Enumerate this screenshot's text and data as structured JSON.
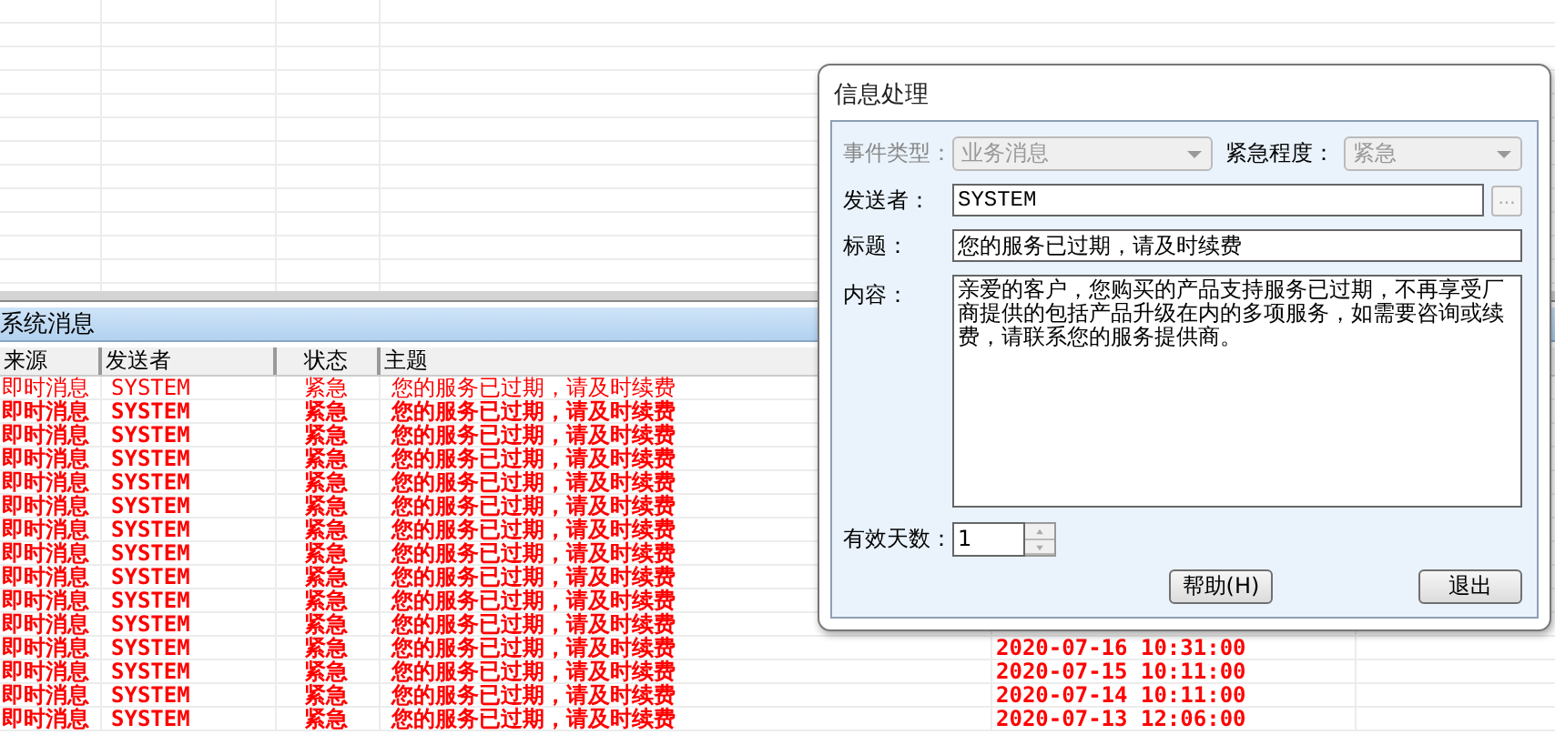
{
  "message_panel": {
    "title": "系统消息",
    "columns": [
      "来源",
      "发送者",
      "状态",
      "主题"
    ],
    "rows": [
      {
        "source": "即时消息",
        "sender": "SYSTEM",
        "status": "紧急",
        "subject": "您的服务已过期，请及时续费",
        "unread": false
      },
      {
        "source": "即时消息",
        "sender": "SYSTEM",
        "status": "紧急",
        "subject": "您的服务已过期，请及时续费",
        "unread": true
      },
      {
        "source": "即时消息",
        "sender": "SYSTEM",
        "status": "紧急",
        "subject": "您的服务已过期，请及时续费",
        "unread": true
      },
      {
        "source": "即时消息",
        "sender": "SYSTEM",
        "status": "紧急",
        "subject": "您的服务已过期，请及时续费",
        "unread": true
      },
      {
        "source": "即时消息",
        "sender": "SYSTEM",
        "status": "紧急",
        "subject": "您的服务已过期，请及时续费",
        "unread": true
      },
      {
        "source": "即时消息",
        "sender": "SYSTEM",
        "status": "紧急",
        "subject": "您的服务已过期，请及时续费",
        "unread": true
      },
      {
        "source": "即时消息",
        "sender": "SYSTEM",
        "status": "紧急",
        "subject": "您的服务已过期，请及时续费",
        "unread": true
      },
      {
        "source": "即时消息",
        "sender": "SYSTEM",
        "status": "紧急",
        "subject": "您的服务已过期，请及时续费",
        "unread": true
      },
      {
        "source": "即时消息",
        "sender": "SYSTEM",
        "status": "紧急",
        "subject": "您的服务已过期，请及时续费",
        "unread": true
      },
      {
        "source": "即时消息",
        "sender": "SYSTEM",
        "status": "紧急",
        "subject": "您的服务已过期，请及时续费",
        "unread": true
      },
      {
        "source": "即时消息",
        "sender": "SYSTEM",
        "status": "紧急",
        "subject": "您的服务已过期，请及时续费",
        "unread": true
      },
      {
        "source": "即时消息",
        "sender": "SYSTEM",
        "status": "紧急",
        "subject": "您的服务已过期，请及时续费",
        "unread": true,
        "time": "2020-07-16 10:31:00"
      },
      {
        "source": "即时消息",
        "sender": "SYSTEM",
        "status": "紧急",
        "subject": "您的服务已过期，请及时续费",
        "unread": true,
        "time": "2020-07-15 10:11:00"
      },
      {
        "source": "即时消息",
        "sender": "SYSTEM",
        "status": "紧急",
        "subject": "您的服务已过期，请及时续费",
        "unread": true,
        "time": "2020-07-14 10:11:00"
      },
      {
        "source": "即时消息",
        "sender": "SYSTEM",
        "status": "紧急",
        "subject": "您的服务已过期，请及时续费",
        "unread": true,
        "time": "2020-07-13 12:06:00"
      }
    ]
  },
  "dialog": {
    "title": "信息处理",
    "event_type": {
      "label": "事件类型：",
      "value": "业务消息",
      "disabled": true
    },
    "urgency": {
      "label": "紧急程度：",
      "value": "紧急",
      "disabled": true
    },
    "sender": {
      "label": "发送者：",
      "value": "SYSTEM"
    },
    "browse_button": "...",
    "subject": {
      "label": "标题：",
      "value": "您的服务已过期，请及时续费"
    },
    "content": {
      "label": "内容：",
      "value": "亲爱的客户，您购买的产品支持服务已过期，不再享受厂商提供的包括产品升级在内的多项服务，如需要咨询或续费，请联系您的服务提供商。"
    },
    "valid_days": {
      "label": "有效天数：",
      "value": "1"
    },
    "buttons": [
      "帮助(H)",
      "退出"
    ]
  }
}
